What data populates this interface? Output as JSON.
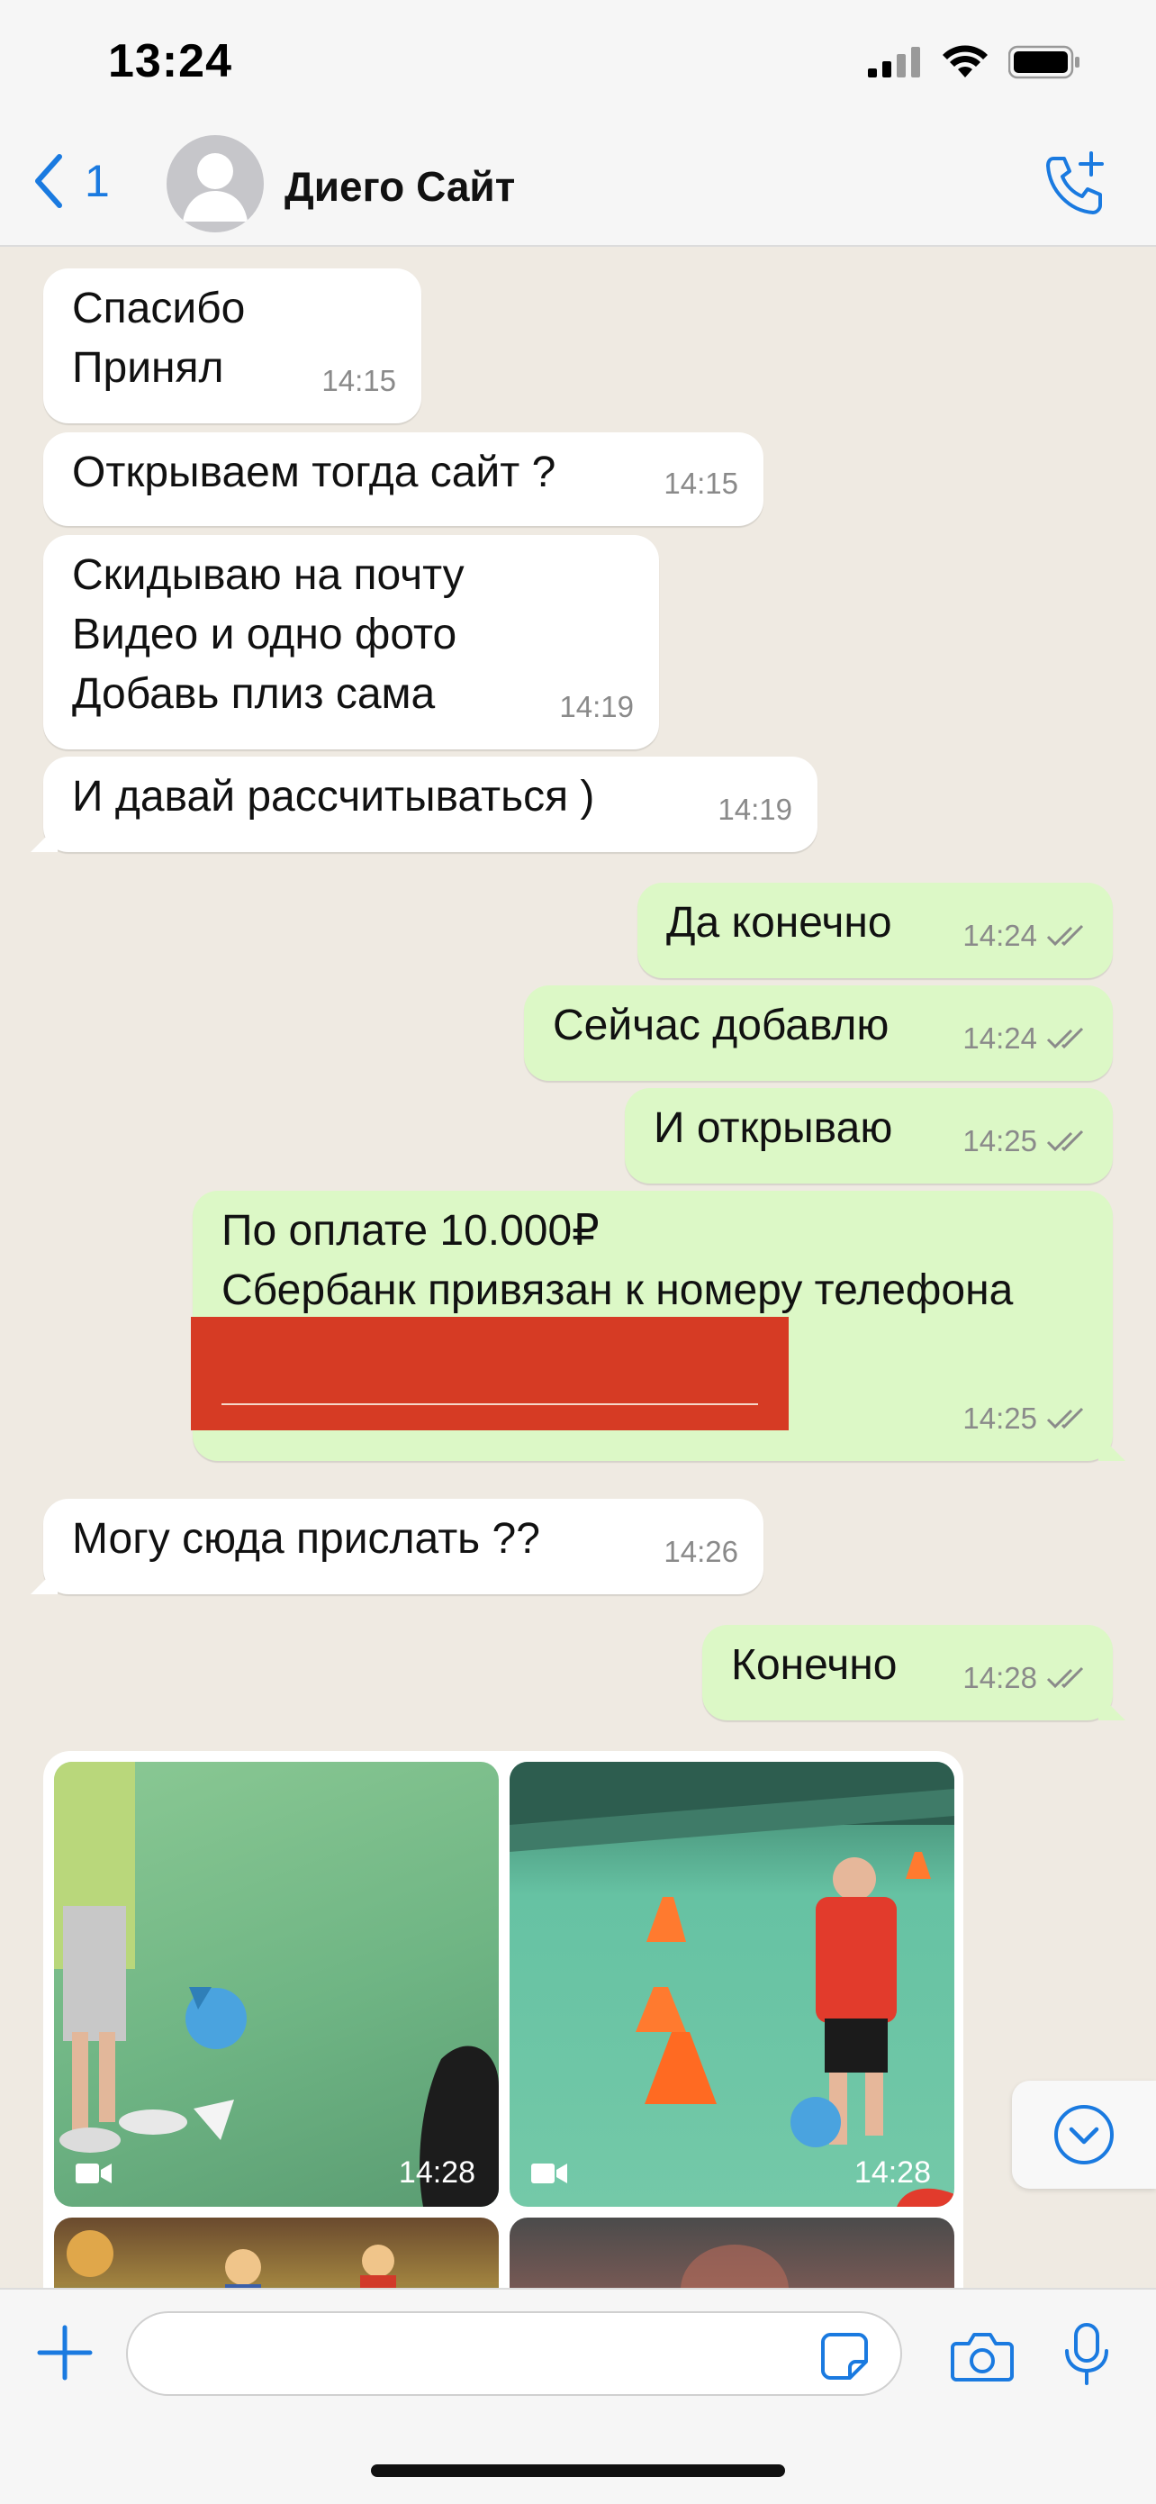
{
  "status_bar": {
    "time": "13:24"
  },
  "header": {
    "back_count": "1",
    "contact_name": "Диего Сайт"
  },
  "colors": {
    "accent": "#1a7ae0",
    "incoming_bubble": "#ffffff",
    "outgoing_bubble": "#dcf8c6",
    "redaction": "#d63b24"
  },
  "messages": [
    {
      "direction": "in",
      "lines": [
        "Спасибо",
        "Принял"
      ],
      "time": "14:15"
    },
    {
      "direction": "in",
      "lines": [
        "Открываем тогда сайт ?"
      ],
      "time": "14:15"
    },
    {
      "direction": "in",
      "lines": [
        "Скидываю на почту",
        "Видео и одно фото",
        "Добавь плиз сама"
      ],
      "time": "14:19"
    },
    {
      "direction": "in",
      "lines": [
        "И давай рассчитываться )"
      ],
      "time": "14:19"
    },
    {
      "direction": "out",
      "lines": [
        "Да конечно"
      ],
      "time": "14:24",
      "status": "read"
    },
    {
      "direction": "out",
      "lines": [
        "Сейчас добавлю"
      ],
      "time": "14:24",
      "status": "read"
    },
    {
      "direction": "out",
      "lines": [
        "И открываю"
      ],
      "time": "14:25",
      "status": "read"
    },
    {
      "direction": "out",
      "lines": [
        "По оплате 10.000₽",
        "Сбербанк привязан к номеру телефона"
      ],
      "time": "14:25",
      "status": "read",
      "redacted_phone": true
    },
    {
      "direction": "in",
      "lines": [
        "Могу сюда прислать ??"
      ],
      "time": "14:26"
    },
    {
      "direction": "out",
      "lines": [
        "Конечно"
      ],
      "time": "14:28",
      "status": "read"
    }
  ],
  "media": [
    {
      "kind": "video",
      "time": "14:28"
    },
    {
      "kind": "video",
      "time": "14:28"
    },
    {
      "kind": "photo",
      "time": ""
    },
    {
      "kind": "photo",
      "time": ""
    }
  ],
  "input": {
    "placeholder": "",
    "value": ""
  },
  "icons": [
    "back-chevron-icon",
    "avatar-placeholder-icon",
    "call-add-icon",
    "read-checks-icon",
    "video-camera-icon",
    "scroll-down-icon",
    "plus-icon",
    "sticker-icon",
    "camera-icon",
    "microphone-icon"
  ]
}
